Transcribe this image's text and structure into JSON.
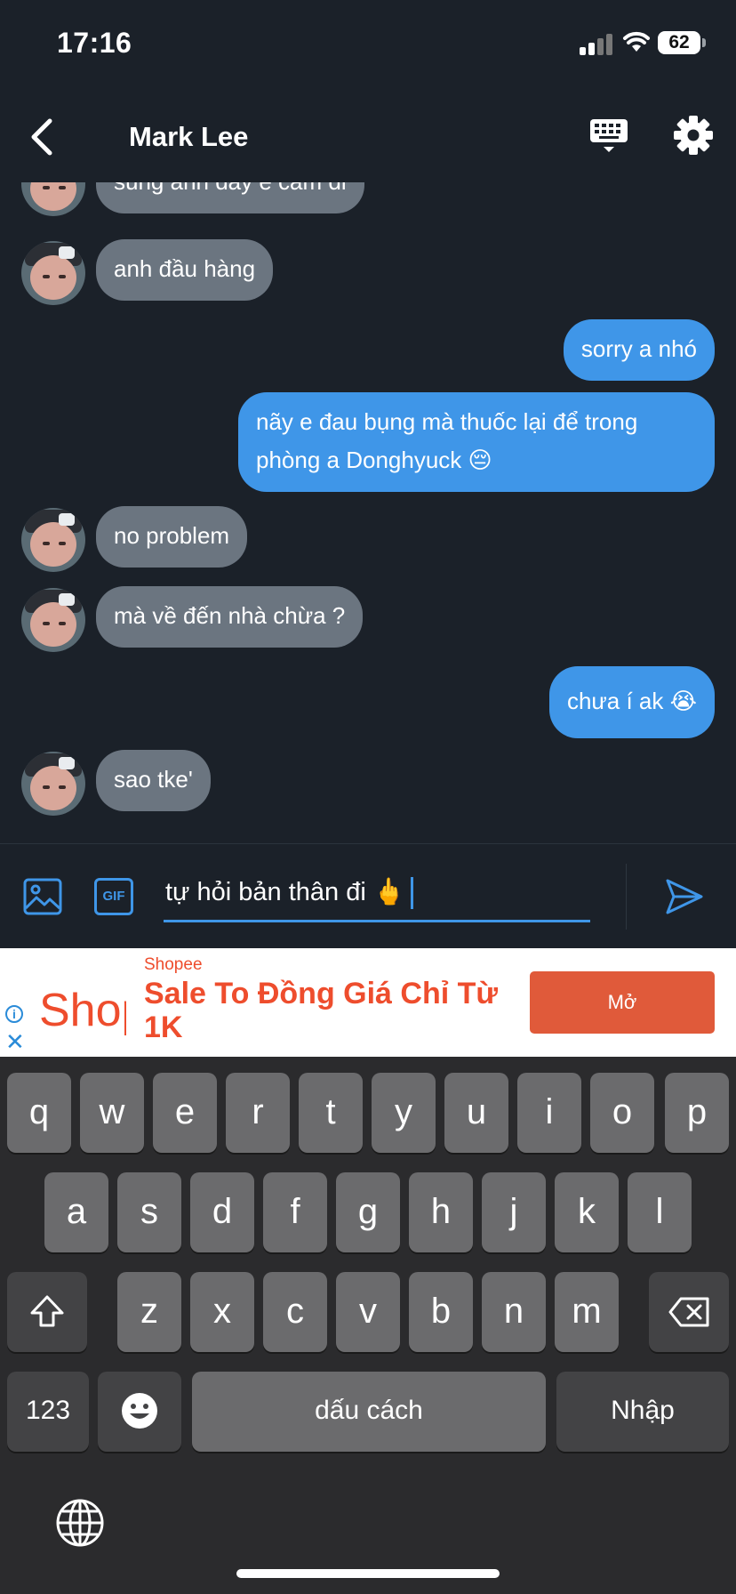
{
  "status": {
    "time": "17:16",
    "battery": "62"
  },
  "header": {
    "title": "Mark Lee",
    "back_icon": "chevron-left-icon",
    "keyboard_icon": "keyboard-icon",
    "settings_icon": "gear-icon"
  },
  "messages": [
    {
      "side": "in",
      "text": "súng anh đây e cầm đi"
    },
    {
      "side": "in",
      "text": "anh đầu hàng"
    },
    {
      "side": "out",
      "text": "sorry a nhó"
    },
    {
      "side": "out",
      "text": "nãy e đau bụng mà thuốc lại để trong phòng a Donghyuck 😔"
    },
    {
      "side": "in",
      "text": "no problem"
    },
    {
      "side": "in",
      "text": "mà về đến nhà chừa ?"
    },
    {
      "side": "out",
      "text": "chưa í ak 😭"
    },
    {
      "side": "in",
      "text": "sao tke'"
    }
  ],
  "composer": {
    "value": "tự hỏi bản thân đi 🖕",
    "gif_label": "GIF",
    "image_icon": "image-icon",
    "send_icon": "send-icon"
  },
  "ad": {
    "logo": "Shopee",
    "brand": "Shopee",
    "headline": "Sale To Đồng Giá Chỉ Từ 1K",
    "button": "Mở",
    "color": "#ee4d2d"
  },
  "keyboard": {
    "row1": [
      "q",
      "w",
      "e",
      "r",
      "t",
      "y",
      "u",
      "i",
      "o",
      "p"
    ],
    "row2": [
      "a",
      "s",
      "d",
      "f",
      "g",
      "h",
      "j",
      "k",
      "l"
    ],
    "row3": [
      "z",
      "x",
      "c",
      "v",
      "b",
      "n",
      "m"
    ],
    "numbers_key": "123",
    "space_key": "dấu cách",
    "return_key": "Nhập"
  },
  "colors": {
    "background": "#1b2129",
    "outgoing": "#3f96e8",
    "incoming": "#6b7580"
  }
}
